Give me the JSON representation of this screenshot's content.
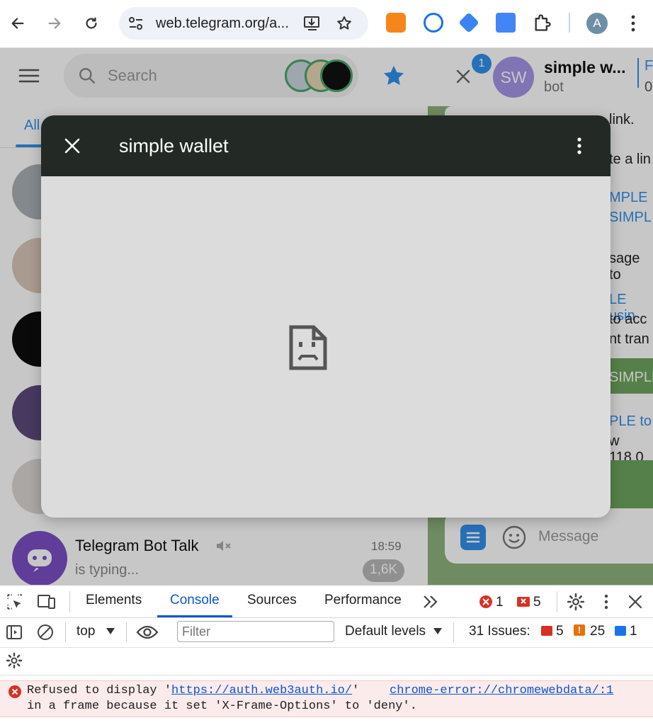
{
  "browser": {
    "url": "web.telegram.org/a...",
    "profile_initial": "A"
  },
  "telegram": {
    "search_placeholder": "Search",
    "folder_tab": "All",
    "chats": [
      {
        "name": "Telegram Bot Talk",
        "time": "18:59",
        "preview": "is typing...",
        "badge": "1,6K"
      }
    ],
    "header": {
      "title": "simple w...",
      "subtitle": "bot",
      "unread_badge": "1",
      "avatar_initials": "SW",
      "right_edge_a": "F",
      "right_edge_b": "0"
    },
    "message_fragments": [
      "link.",
      "te a lin",
      "MPLE",
      "SIMPL",
      "sage to",
      "LE usin",
      "to acc",
      "nt tran",
      "SIMPLE",
      "PLE to",
      "w 118.0"
    ],
    "message_placeholder": "Message"
  },
  "modal": {
    "title": "simple wallet"
  },
  "devtools": {
    "tabs": [
      "Elements",
      "Console",
      "Sources",
      "Performance"
    ],
    "error_count": "1",
    "issue_count": "5",
    "context": "top",
    "filter_placeholder": "Filter",
    "levels": "Default levels",
    "issues_label": "31 Issues:",
    "issues_errors": "5",
    "issues_warnings": "25",
    "issues_info": "1",
    "error_message": {
      "prefix": "Refused to display '",
      "link": "https://auth.web3auth.io/",
      "suffix": "'",
      "source": "chrome-error://chromewebdata/:1",
      "line2": "in a frame because it set 'X-Frame-Options' to 'deny'."
    }
  },
  "colors": {
    "modal_header": "#232a26",
    "accent_blue": "#3390ec",
    "chat_bg": "#8fb37d",
    "devtools_blue": "#0b57d0",
    "error_red": "#d93025"
  }
}
